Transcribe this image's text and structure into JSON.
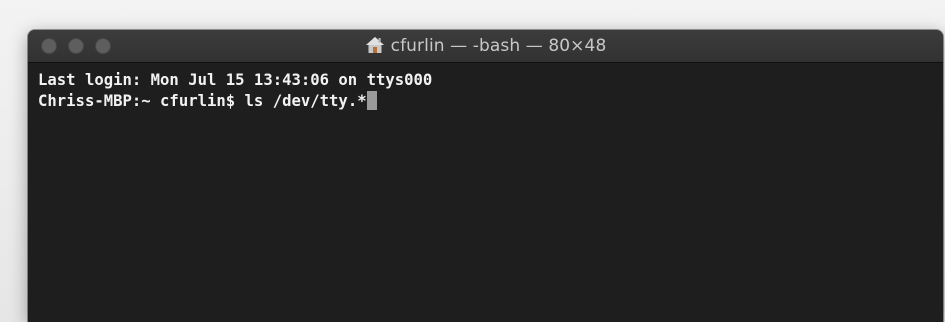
{
  "window": {
    "title": "cfurlin — -bash — 80×48",
    "title_icon": "home-icon"
  },
  "terminal": {
    "lines": [
      "Last login: Mon Jul 15 13:43:06 on ttys000"
    ],
    "prompt": "Chriss-MBP:~ cfurlin$ ",
    "command": "ls /dev/tty.*"
  },
  "colors": {
    "terminal_bg": "#1e1e1e",
    "terminal_fg": "#f2f2f2",
    "titlebar_bg": "#3a3a3a",
    "cursor": "#9a9a9a",
    "traffic_light_inactive": "#5e5e5e"
  }
}
